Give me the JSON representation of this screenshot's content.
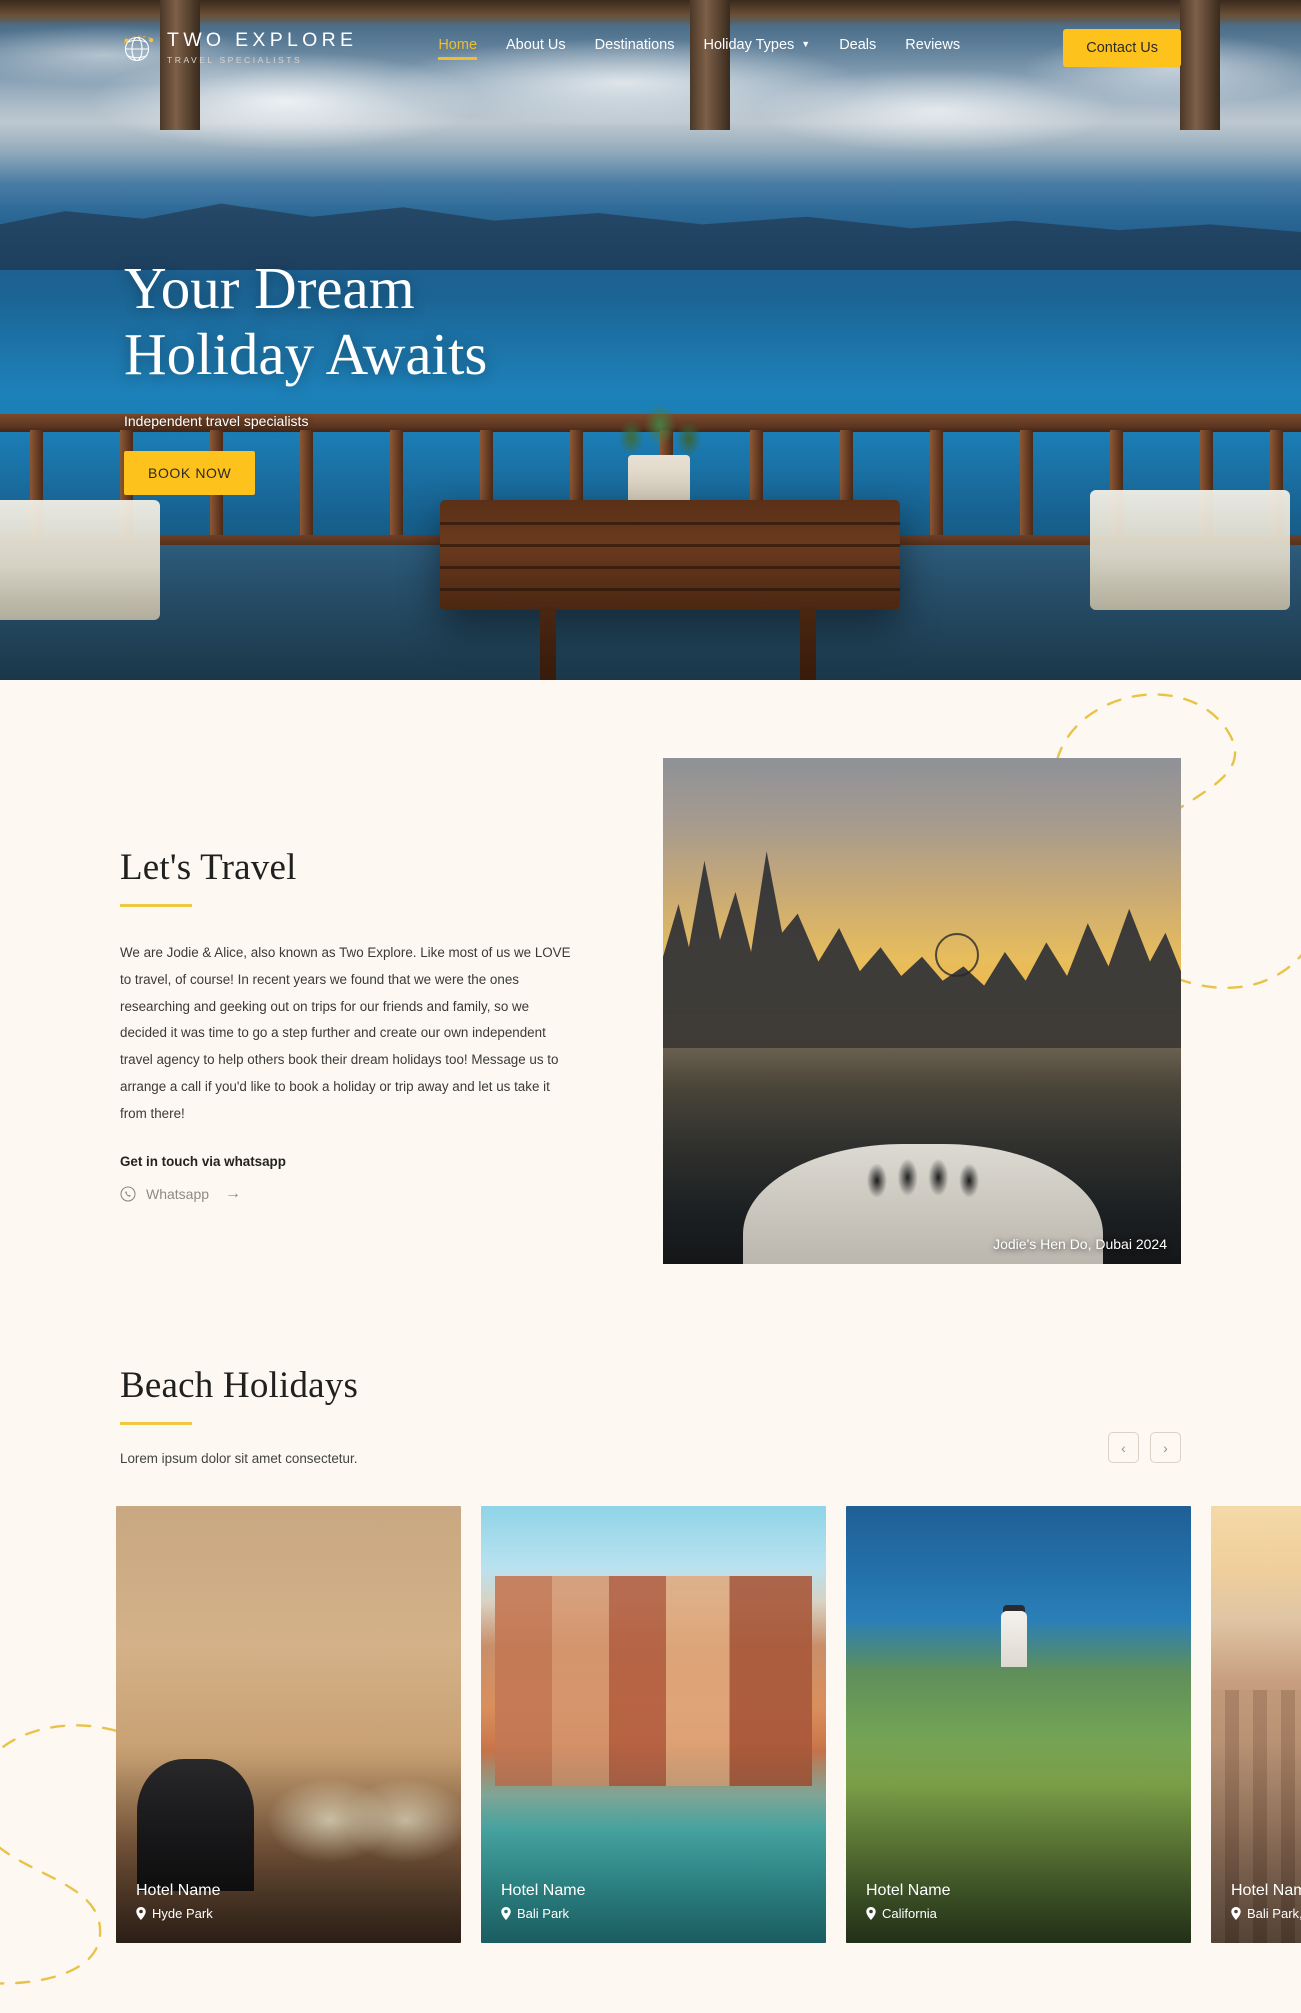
{
  "brand": {
    "name": "TWO EXPLORE",
    "tagline": "TRAVEL SPECIALISTS",
    "logo_icon": "globe-icon"
  },
  "nav": {
    "links": [
      {
        "label": "Home",
        "active": true
      },
      {
        "label": "About Us",
        "active": false
      },
      {
        "label": "Destinations",
        "active": false
      },
      {
        "label": "Holiday Types",
        "active": false,
        "has_dropdown": true,
        "caret": "▼"
      },
      {
        "label": "Deals",
        "active": false
      },
      {
        "label": "Reviews",
        "active": false
      }
    ],
    "contact_button": "Contact Us",
    "accent_color": "#F0BD2C",
    "button_color": "#FDC21C"
  },
  "hero": {
    "title_line1": "Your Dream",
    "title_line2": "Holiday Awaits",
    "subtitle": "Independent travel specialists",
    "cta_label": "BOOK NOW"
  },
  "travel": {
    "title": "Let's Travel",
    "body": "We are Jodie & Alice, also known as Two Explore. Like most of us we LOVE to travel, of course! In recent years we found that we were the ones researching and geeking out on trips for our friends and family, so we decided it was time to go a step further and create our own independent travel agency to help others book their dream holidays too! Message us to arrange a call if you'd like to book a holiday or trip away and let us take it from there!",
    "cta_heading": "Get in touch via whatsapp",
    "whatsapp_label": "Whatsapp",
    "whatsapp_arrow": "→",
    "photo_caption": "Jodie's Hen Do, Dubai 2024"
  },
  "beach": {
    "title": "Beach Holidays",
    "subtitle": "Lorem ipsum dolor sit amet consectetur.",
    "prev_label": "‹",
    "next_label": "›",
    "cards": [
      {
        "title": "Hotel Name",
        "location": "Hyde Park",
        "art": "img-hotel"
      },
      {
        "title": "Hotel Name",
        "location": "Bali Park",
        "art": "img-venice"
      },
      {
        "title": "Hotel Name",
        "location": "California",
        "art": "img-lighthouse"
      },
      {
        "title": "Hotel Name",
        "location": "Bali Park,",
        "art": "img-city"
      }
    ]
  },
  "theme": {
    "page_background": "#FDF8F2",
    "accent_yellow": "#EFC844",
    "decor_dash_color": "#E8C347"
  }
}
